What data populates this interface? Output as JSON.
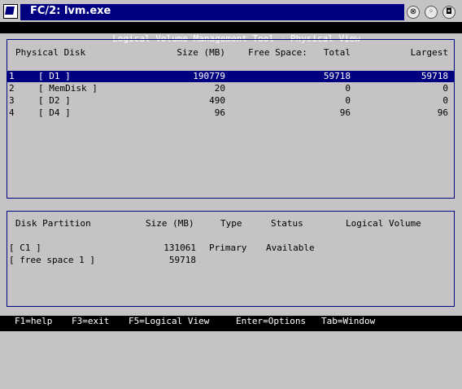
{
  "window": {
    "title": "FC/2: lvm.exe",
    "icon": "app-window-icon",
    "buttons": {
      "close": "⊗",
      "minimize": "◦",
      "maximize": "◘"
    }
  },
  "header": {
    "title": "Logical Volume Management Tool - Physical View"
  },
  "disk_table": {
    "headers": {
      "physical_disk": "Physical Disk",
      "size": "Size (MB)",
      "free_space": "Free Space:",
      "total": "Total",
      "largest": "Largest"
    },
    "rows": [
      {
        "num": "1",
        "name": "[ D1 ]",
        "size": "190779",
        "total": "59718",
        "largest": "59718"
      },
      {
        "num": "2",
        "name": "[ MemDisk ]",
        "size": "20",
        "total": "0",
        "largest": "0"
      },
      {
        "num": "3",
        "name": "[ D2 ]",
        "size": "490",
        "total": "0",
        "largest": "0"
      },
      {
        "num": "4",
        "name": "[ D4 ]",
        "size": "96",
        "total": "96",
        "largest": "96"
      }
    ]
  },
  "partition_table": {
    "headers": {
      "disk_partition": "Disk Partition",
      "size": "Size (MB)",
      "type": "Type",
      "status": "Status",
      "logical_volume": "Logical Volume"
    },
    "rows": [
      {
        "name": "[ C1 ]",
        "size": "131061",
        "type": "Primary",
        "status": "Available",
        "volume": ""
      },
      {
        "name": "[ free space 1 ]",
        "size": "59718",
        "type": "",
        "status": "",
        "volume": ""
      }
    ]
  },
  "footer": {
    "help": "F1=help",
    "exit": "F3=exit",
    "logical_view": "F5=Logical View",
    "options": "Enter=Options",
    "window": "Tab=Window"
  },
  "colors": {
    "selection": "#000080",
    "background": "#c6c3c6",
    "title_bar": "#000080"
  }
}
